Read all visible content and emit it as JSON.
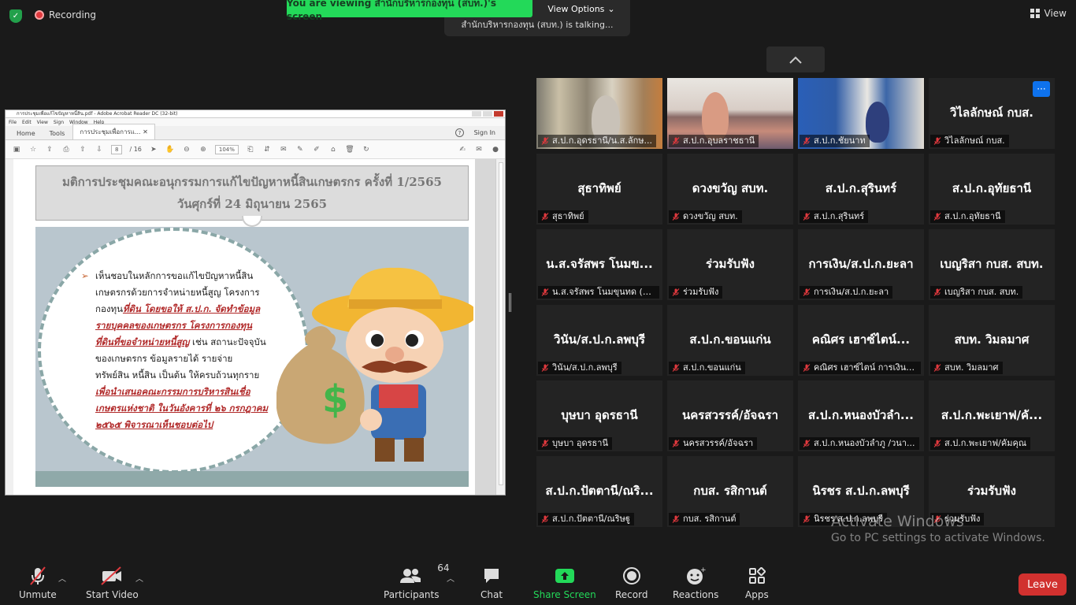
{
  "top": {
    "recording_label": "Recording",
    "viewing_banner": "You are viewing สำนักบริหารกองทุน (สบท.)'s screen",
    "view_options": "View Options",
    "talking": "สำนักบริหารกองทุน (สบท.) is talking...",
    "view_label": "View"
  },
  "acrobat": {
    "window_title": "การประชุมเพื่อแก้ไขปัญหาหนี้สิน.pdf - Adobe Acrobat Reader DC (32-bit)",
    "menu": [
      "File",
      "Edit",
      "View",
      "Sign",
      "Window",
      "Help"
    ],
    "tabs": [
      "Home",
      "Tools",
      "การประชุมเพื่อการแ..."
    ],
    "sign_in": "Sign In",
    "page_current": "8",
    "page_total": "/ 16",
    "zoom": "104%"
  },
  "slide": {
    "title_line1": "มติการประชุมคณะอนุกรรมการแก้ไขปัญหาหนี้สินเกษตรกร ครั้งที่ 1/2565",
    "title_line2": "วันศุกร์ที่ 24 มิถุนายน 2565",
    "body_part1": "เห็นชอบในหลักการขอแก้ไขปัญหาหนี้สินเกษตรกรด้วยการจำหน่ายหนี้สูญ โครงการกองทุน",
    "body_red1": "ที่ดิน โดยขอให้ ส.ป.ก. จัดทำข้อมูลรายบุคคลของเกษตรกร โครงการกองทุนที่ดินที่ขอจำหน่ายหนี้สูญ",
    "body_part2": " เช่น สถานะปัจจุบันของเกษตรกร ข้อมูลรายได้ รายจ่าย ทรัพย์สิน หนี้สิน เป็นต้น ให้ครบถ้วนทุกราย ",
    "body_red2": "เพื่อนำเสนอคณะกรรมการบริหารสินเชื่อเกษตรแห่งชาติ ในวันอังคารที่ ๒๖ กรกฎาคม ๒๕๖๕ พิจารณาเห็นชอบต่อไป"
  },
  "participants": [
    {
      "big": "",
      "label": "ส.ป.ก.อุดรธานี/น.ส.ลักษ..."
    },
    {
      "big": "",
      "label": "ส.ป.ก.อุบลราชธานี"
    },
    {
      "big": "",
      "label": "ส.ป.ก.ชัยนาท"
    },
    {
      "big": "วิไลลักษณ์ กบส.",
      "label": "วิไลลักษณ์ กบส."
    },
    {
      "big": "สุธาทิพย์",
      "label": "สุธาทิพย์"
    },
    {
      "big": "ดวงขวัญ สบท.",
      "label": "ดวงขวัญ สบท."
    },
    {
      "big": "ส.ป.ก.สุรินทร์",
      "label": "ส.ป.ก.สุรินทร์"
    },
    {
      "big": "ส.ป.ก.อุทัยธานี",
      "label": "ส.ป.ก.อุทัยธานี"
    },
    {
      "big": "น.ส.จรัสพร โนมข...",
      "label": "น.ส.จรัสพร โนมขุนทด (ส..."
    },
    {
      "big": "ร่วมรับฟัง",
      "label": "ร่วมรับฟัง"
    },
    {
      "big": "การเงิน/ส.ป.ก.ยะลา",
      "label": "การเงิน/ส.ป.ก.ยะลา"
    },
    {
      "big": "เบญริสา กบส. สบท.",
      "label": "เบญริสา กบส. สบท."
    },
    {
      "big": "วินัน/ส.ป.ก.ลพบุรี",
      "label": "วินัน/ส.ป.ก.ลพบุรี"
    },
    {
      "big": "ส.ป.ก.ขอนแก่น",
      "label": "ส.ป.ก.ขอนแก่น"
    },
    {
      "big": "คณิศร เฮาซ์ไตน์...",
      "label": "คณิศร เฮาซ์ไตน์ การเงินฯ..."
    },
    {
      "big": "สบท. วิมลมาศ",
      "label": "สบท. วิมลมาศ"
    },
    {
      "big": "บุษบา อุดรธานี",
      "label": "บุษบา อุดรธานี"
    },
    {
      "big": "นครสวรรค์/อัจฉรา",
      "label": "นครสวรรค์/อัจฉรา"
    },
    {
      "big": "ส.ป.ก.หนองบัวลำ...",
      "label": "ส.ป.ก.หนองบัวลำภู /วนา..."
    },
    {
      "big": "ส.ป.ก.พะเยาฟ/คั...",
      "label": "ส.ป.ก.พะเยาฟ/คัมคุณ"
    },
    {
      "big": "ส.ป.ก.ปัตตานี/ณริ...",
      "label": "ส.ป.ก.ปัตตานี/ณริษฐู"
    },
    {
      "big": "กบส. รสิกานต์",
      "label": "กบส. รสิกานต์"
    },
    {
      "big": "นิรชร ส.ป.ก.ลพบุรี",
      "label": "นิรชร ส.ป.ก.ลพบุรี"
    },
    {
      "big": "ร่วมรับฟัง",
      "label": "ร่วมรับฟัง"
    }
  ],
  "watermark": {
    "line1": "Activate Windows",
    "line2": "Go to PC settings to activate Windows."
  },
  "toolbar": {
    "unmute": "Unmute",
    "start_video": "Start Video",
    "participants": "Participants",
    "participants_count": "64",
    "chat": "Chat",
    "share_screen": "Share Screen",
    "record": "Record",
    "reactions": "Reactions",
    "apps": "Apps",
    "leave": "Leave"
  },
  "colors": {
    "share_green": "#23d959",
    "leave_red": "#d1312f",
    "more_blue": "#0e72ed"
  }
}
